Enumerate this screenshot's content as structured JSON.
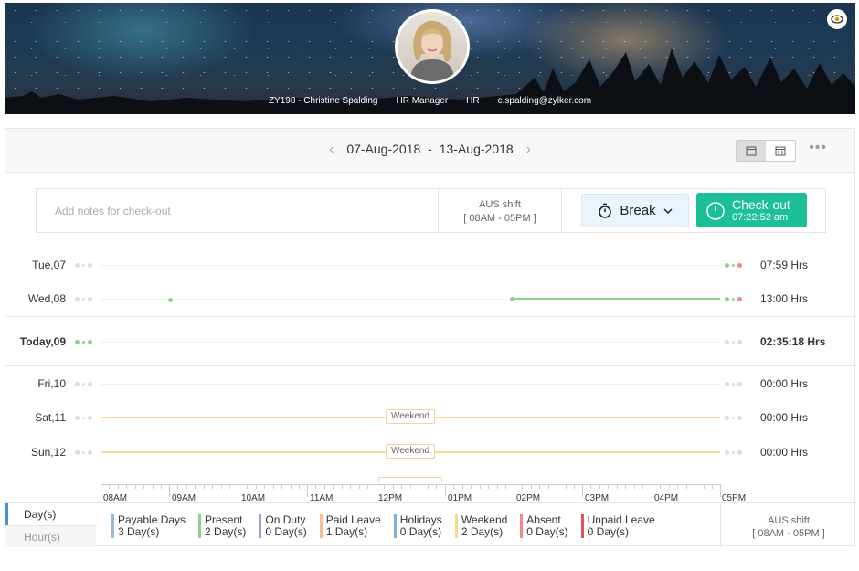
{
  "profile": {
    "employee_id_name": "ZY198 - Christine Spalding",
    "designation": "HR Manager",
    "department": "HR",
    "email": "c.spalding@zylker.com",
    "eye_icon": "eye-icon"
  },
  "toolbar": {
    "start_date": "07-Aug-2018",
    "separator": "-",
    "end_date": "13-Aug-2018",
    "prev_icon": "‹",
    "next_icon": "›",
    "more": "•••"
  },
  "checkin": {
    "notes_placeholder": "Add notes for check-out",
    "shift_name": "AUS shift",
    "shift_time": "[ 08AM - 05PM ]",
    "break_label": "Break",
    "checkout_label": "Check-out",
    "checkout_time": "07:22:52 am"
  },
  "days": [
    {
      "label": "Tue,07",
      "hours": "07:59 Hrs"
    },
    {
      "label": "Wed,08",
      "hours": "13:00 Hrs"
    },
    {
      "label": "Today,09",
      "hours": "02:35:18 Hrs"
    },
    {
      "label": "Fri,10",
      "hours": "00:00 Hrs"
    },
    {
      "label": "Sat,11",
      "hours": "00:00 Hrs",
      "badge": "Weekend"
    },
    {
      "label": "Sun,12",
      "hours": "00:00 Hrs",
      "badge": "Weekend"
    }
  ],
  "axis": [
    "08AM",
    "09AM",
    "10AM",
    "11AM",
    "12PM",
    "01PM",
    "02PM",
    "03PM",
    "04PM",
    "05PM"
  ],
  "footer": {
    "tab_day": "Day(s)",
    "tab_hour": "Hour(s)",
    "legend": [
      {
        "name": "Payable Days",
        "value": "3 Day(s)",
        "color": "#9ab8d9"
      },
      {
        "name": "Present",
        "value": "2 Day(s)",
        "color": "#8fd18c"
      },
      {
        "name": "On Duty",
        "value": "0 Day(s)",
        "color": "#a79ad6"
      },
      {
        "name": "Paid Leave",
        "value": "1 Day(s)",
        "color": "#f5c08b"
      },
      {
        "name": "Holidays",
        "value": "0 Day(s)",
        "color": "#7fb0d8"
      },
      {
        "name": "Weekend",
        "value": "2 Day(s)",
        "color": "#f7d98e"
      },
      {
        "name": "Absent",
        "value": "0 Day(s)",
        "color": "#f2888c"
      },
      {
        "name": "Unpaid Leave",
        "value": "0 Day(s)",
        "color": "#e0535d"
      }
    ],
    "shift_name": "AUS shift",
    "shift_time": "[ 08AM - 05PM ]"
  }
}
